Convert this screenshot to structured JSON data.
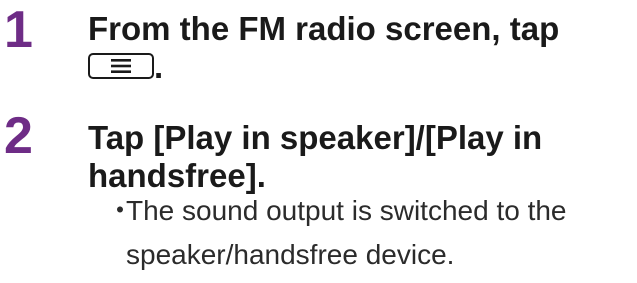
{
  "steps": [
    {
      "number": "1",
      "text_line1": "From the FM radio screen, tap",
      "text_line2_suffix": ".",
      "key_icon": "menu-icon"
    },
    {
      "number": "2",
      "text_line1": "Tap [Play in speaker]/[Play in",
      "text_line2": "handsfree].",
      "note": {
        "bullet": "・",
        "line1": "The sound output is switched to the",
        "line2": "speaker/handsfree device."
      }
    }
  ],
  "colors": {
    "step_number": "#6e2c86",
    "text": "#1a1a1a"
  }
}
